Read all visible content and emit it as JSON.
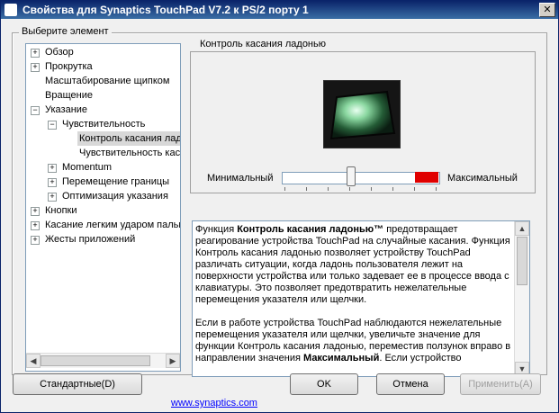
{
  "title": "Свойства для Synaptics TouchPad V7.2 к PS/2 порту 1",
  "close_glyph": "✕",
  "group_label": "Выберите элемент",
  "tree": [
    {
      "label": "Обзор",
      "expander": "+"
    },
    {
      "label": "Прокрутка",
      "expander": "+"
    },
    {
      "label": "Масштабирование щипком",
      "expander": ""
    },
    {
      "label": "Вращение",
      "expander": ""
    },
    {
      "label": "Указание",
      "expander": "−"
    },
    {
      "label": "Чувствительность",
      "expander": "−"
    },
    {
      "label": "Контроль касания ладонью",
      "expander": ""
    },
    {
      "label": "Чувствительность касания",
      "expander": ""
    },
    {
      "label": "Momentum",
      "expander": "+"
    },
    {
      "label": "Перемещение границы",
      "expander": "+"
    },
    {
      "label": "Оптимизация указания",
      "expander": "+"
    },
    {
      "label": "Кнопки",
      "expander": "+"
    },
    {
      "label": "Касание легким ударом пальца",
      "expander": "+"
    },
    {
      "label": "Жесты приложений",
      "expander": "+"
    }
  ],
  "palm_panel": {
    "label": "Контроль касания ладонью",
    "min_label": "Минимальный",
    "max_label": "Максимальный",
    "slider_value": 0.43
  },
  "description": {
    "p1_prefix": "Функция ",
    "p1_bold": "Контроль касания ладонью™",
    "p1_rest": " предотвращает реагирование устройства TouchPad на случайные касания. Функция Контроль касания ладонью позволяет устройству TouchPad различать ситуации, когда ладонь пользователя лежит на поверхности устройства или только задевает ее в процессе ввода с клавиатуры. Это позволяет предотвратить нежелательные перемещения указателя или щелчки.",
    "p2_prefix": "Если в работе устройства TouchPad наблюдаются нежелательные перемещения указателя или щелчки, увеличьте значение для функции Контроль касания ладонью, переместив ползунок вправо в направлении значения ",
    "p2_bold": "Максимальный",
    "p2_rest": ". Если устройство"
  },
  "buttons": {
    "defaults": "Стандартные(D)",
    "link": "www.synaptics.com",
    "ok": "OK",
    "cancel": "Отмена",
    "apply": "Применить(A)"
  },
  "colors": {
    "slider_max_fill": "#e00000",
    "link": "#0000ff"
  }
}
